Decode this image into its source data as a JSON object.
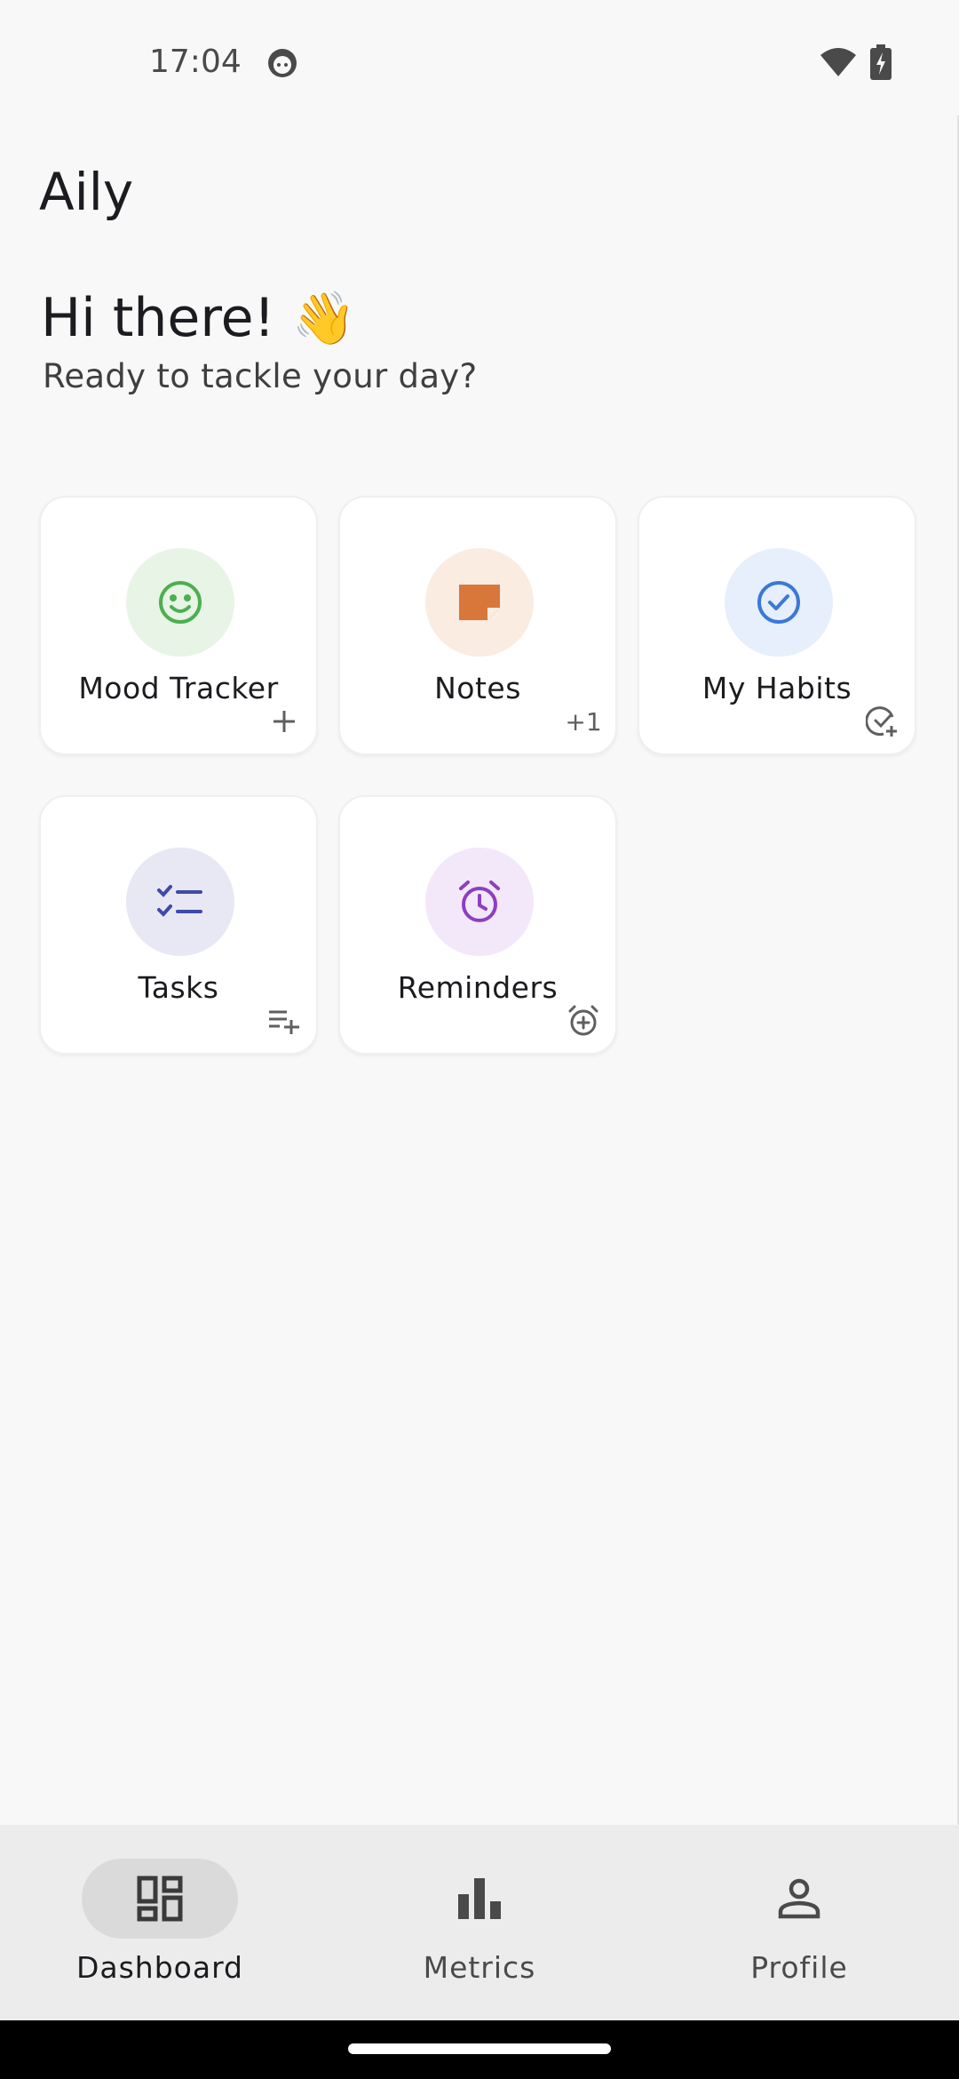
{
  "status_bar": {
    "time": "17:04"
  },
  "app": {
    "title": "Aily"
  },
  "greeting": {
    "title": "Hi there!",
    "emoji": "👋",
    "subtitle": "Ready to tackle your day?"
  },
  "cards": [
    {
      "label": "Mood Tracker",
      "icon": "smile-icon",
      "action_icon": "plus-icon",
      "color": "#4caf50",
      "bg": "#e7f4e6"
    },
    {
      "label": "Notes",
      "icon": "note-icon",
      "action_text": "+1",
      "color": "#d9773a",
      "bg": "#fbece2"
    },
    {
      "label": "My Habits",
      "icon": "check-circle-icon",
      "action_icon": "check-plus-icon",
      "color": "#3b78d8",
      "bg": "#e6effb"
    },
    {
      "label": "Tasks",
      "icon": "checklist-icon",
      "action_icon": "playlist-add-icon",
      "color": "#3f4aa8",
      "bg": "#e7e8f4"
    },
    {
      "label": "Reminders",
      "icon": "alarm-icon",
      "action_icon": "alarm-add-icon",
      "color": "#8e3fbf",
      "bg": "#f3e8fa"
    }
  ],
  "nav": {
    "items": [
      {
        "label": "Dashboard",
        "icon": "dashboard-icon",
        "active": true
      },
      {
        "label": "Metrics",
        "icon": "bar-chart-icon",
        "active": false
      },
      {
        "label": "Profile",
        "icon": "person-icon",
        "active": false
      }
    ]
  }
}
